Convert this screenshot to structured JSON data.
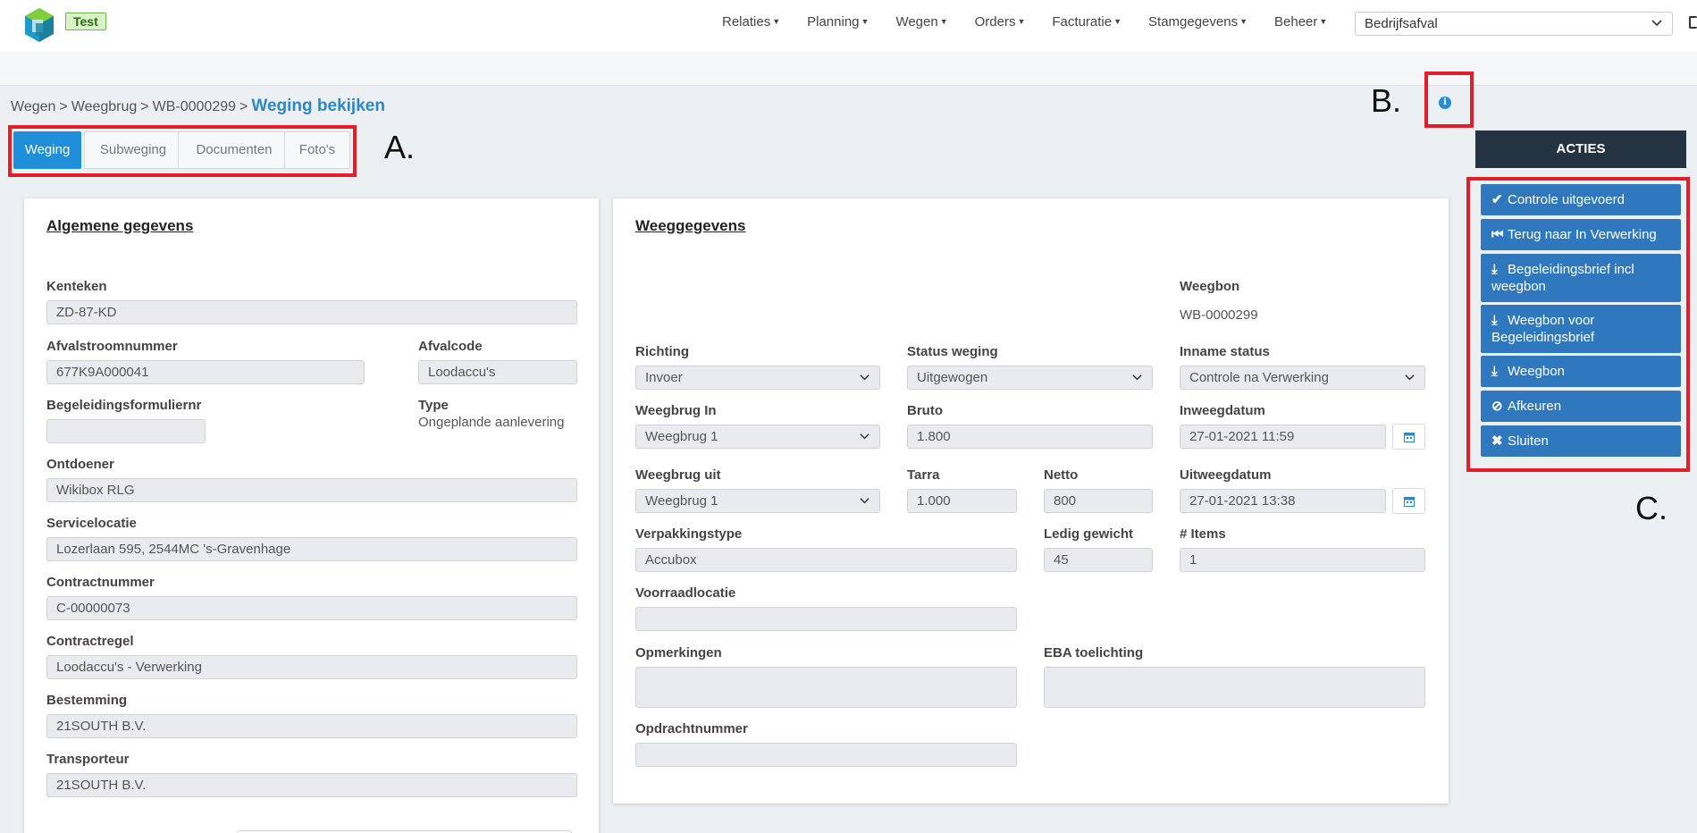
{
  "header": {
    "env_badge": "Test",
    "nav": [
      {
        "label": "Relaties"
      },
      {
        "label": "Planning"
      },
      {
        "label": "Wegen"
      },
      {
        "label": "Orders"
      },
      {
        "label": "Facturatie"
      },
      {
        "label": "Stamgegevens"
      },
      {
        "label": "Beheer"
      }
    ],
    "company_select": "Bedrijfsafval"
  },
  "breadcrumb": {
    "items": [
      "Wegen",
      "Weegbrug",
      "WB-0000299"
    ],
    "separator": ">",
    "current": "Weging bekijken"
  },
  "tabs": [
    {
      "label": "Weging",
      "active": true
    },
    {
      "label": "Subweging",
      "active": false
    },
    {
      "label": "Documenten",
      "active": false
    },
    {
      "label": "Foto's",
      "active": false
    }
  ],
  "annotations": {
    "a": "A.",
    "b": "B.",
    "c": "C."
  },
  "algemene": {
    "title": "Algemene gegevens",
    "kenteken_label": "Kenteken",
    "kenteken": "ZD-87-KD",
    "afvalstroom_label": "Afvalstroomnummer",
    "afvalstroom": "677K9A000041",
    "afvalcode_label": "Afvalcode",
    "afvalcode": "Loodaccu's",
    "begeleiding_label": "Begeleidingsformuliernr",
    "begeleiding": "",
    "type_label": "Type",
    "type": "Ongeplande aanlevering",
    "ontdoener_label": "Ontdoener",
    "ontdoener": "Wikibox RLG",
    "servicelocatie_label": "Servicelocatie",
    "servicelocatie": "Lozerlaan 595, 2544MC  's-Gravenhage",
    "contractnummer_label": "Contractnummer",
    "contractnummer": "C-00000073",
    "contractregel_label": "Contractregel",
    "contractregel": "Loodaccu's - Verwerking",
    "bestemming_label": "Bestemming",
    "bestemming": "21SOUTH B.V.",
    "transporteur_label": "Transporteur",
    "transporteur": "21SOUTH B.V."
  },
  "weeg": {
    "title": "Weeggegevens",
    "weegbon_label": "Weegbon",
    "weegbon": "WB-0000299",
    "richting_label": "Richting",
    "richting": "Invoer",
    "status_label": "Status weging",
    "status": "Uitgewogen",
    "inname_label": "Inname status",
    "inname": "Controle na Verwerking",
    "weegbrug_in_label": "Weegbrug In",
    "weegbrug_in": "Weegbrug 1",
    "bruto_label": "Bruto",
    "bruto": "1.800",
    "inweeg_label": "Inweegdatum",
    "inweeg": "27-01-2021 11:59",
    "weegbrug_uit_label": "Weegbrug uit",
    "weegbrug_uit": "Weegbrug 1",
    "tarra_label": "Tarra",
    "tarra": "1.000",
    "netto_label": "Netto",
    "netto": "800",
    "uitweeg_label": "Uitweegdatum",
    "uitweeg": "27-01-2021 13:38",
    "verpakking_label": "Verpakkingstype",
    "verpakking": "Accubox",
    "ledig_label": "Ledig gewicht",
    "ledig": "45",
    "items_label": "# Items",
    "items": "1",
    "voorraad_label": "Voorraadlocatie",
    "voorraad": "",
    "opmerkingen_label": "Opmerkingen",
    "opmerkingen": "",
    "eba_label": "EBA toelichting",
    "eba": "",
    "opdracht_label": "Opdrachtnummer",
    "opdracht": ""
  },
  "acties": {
    "title": "ACTIES",
    "buttons": [
      {
        "label": "Controle uitgevoerd",
        "icon": "check-icon"
      },
      {
        "label": "Terug naar In Verwerking",
        "icon": "step-backward-icon"
      },
      {
        "label": "Begeleidingsbrief incl weegbon",
        "icon": "download-icon"
      },
      {
        "label": "Weegbon voor Begeleidingsbrief",
        "icon": "download-icon"
      },
      {
        "label": "Weegbon",
        "icon": "download-icon"
      },
      {
        "label": "Afkeuren",
        "icon": "ban-icon"
      },
      {
        "label": "Sluiten",
        "icon": "close-icon"
      }
    ]
  },
  "colors": {
    "primary": "#1e8fd8",
    "action_button": "#2f78bd",
    "acties_header": "#243342",
    "annotation_red": "#e21e2b",
    "badge_green": "#d8f2c8"
  }
}
